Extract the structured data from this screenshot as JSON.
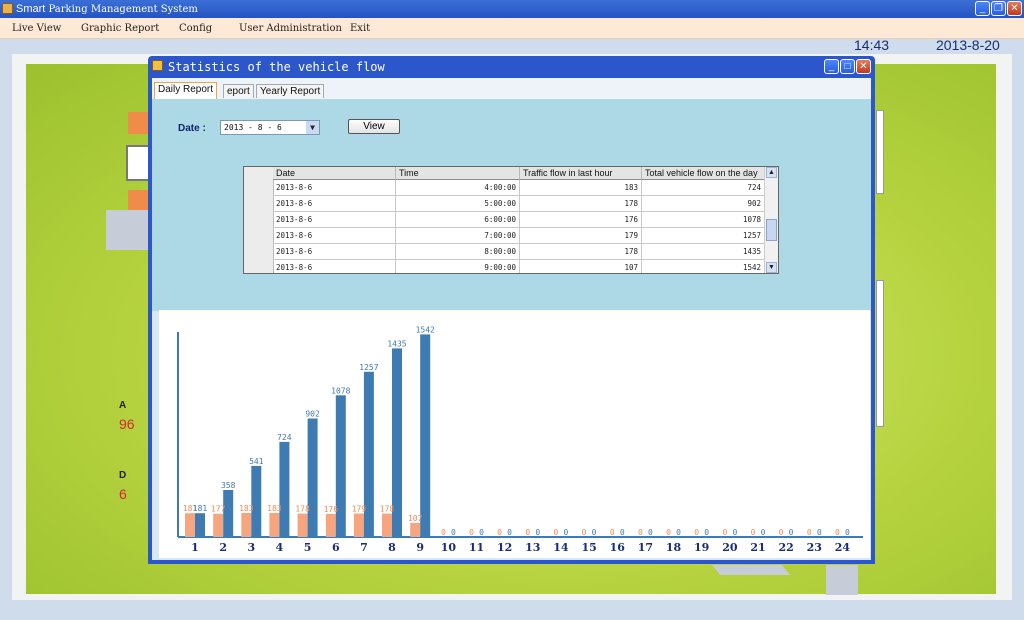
{
  "app": {
    "title_prefix": "Smart",
    "title_rest": "Parking Management System",
    "window_buttons": [
      "_",
      "❐",
      "✕"
    ]
  },
  "menu": [
    "Live View",
    "Graphic Report",
    "Config",
    "User Administration",
    "Exit"
  ],
  "clock": {
    "time": "14:43",
    "date": "2013-8-20"
  },
  "side_labels": [
    {
      "letter": "A",
      "count": "96"
    },
    {
      "letter": "D",
      "count": "6"
    }
  ],
  "dialog": {
    "title": "Statistics of the vehicle flow",
    "tabs": [
      "Daily Report",
      "eport",
      "Yearly Report"
    ],
    "date_label": "Date :",
    "date_value": "2013 - 8 - 6",
    "view_button": "View",
    "table": {
      "columns": [
        "Date",
        "Time",
        "Traffic flow in last hour",
        "Total vehicle flow on the day"
      ],
      "rows": [
        [
          "2013-8-6",
          "4:00:00",
          "183",
          "724"
        ],
        [
          "2013-8-6",
          "5:00:00",
          "178",
          "902"
        ],
        [
          "2013-8-6",
          "6:00:00",
          "176",
          "1078"
        ],
        [
          "2013-8-6",
          "7:00:00",
          "179",
          "1257"
        ],
        [
          "2013-8-6",
          "8:00:00",
          "178",
          "1435"
        ],
        [
          "2013-8-6",
          "9:00:00",
          "107",
          "1542"
        ]
      ]
    }
  },
  "colors": {
    "hourly_bar": "#f7a57e",
    "total_bar": "#3f7bb3",
    "axis_label": "#1b2d72"
  },
  "chart_data": {
    "type": "bar",
    "categories": [
      "1",
      "2",
      "3",
      "4",
      "5",
      "6",
      "7",
      "8",
      "9",
      "10",
      "11",
      "12",
      "13",
      "14",
      "15",
      "16",
      "17",
      "18",
      "19",
      "20",
      "21",
      "22",
      "23",
      "24"
    ],
    "series": [
      {
        "values": [
          181,
          177,
          183,
          183,
          178,
          176,
          179,
          178,
          107,
          0,
          0,
          0,
          0,
          0,
          0,
          0,
          0,
          0,
          0,
          0,
          0,
          0,
          0,
          0
        ]
      },
      {
        "values": [
          181,
          358,
          541,
          724,
          902,
          1078,
          1257,
          1435,
          1542,
          0,
          0,
          0,
          0,
          0,
          0,
          0,
          0,
          0,
          0,
          0,
          0,
          0,
          0,
          0
        ]
      }
    ],
    "value_labels_hourly": [
      "181",
      "177",
      "183",
      "183",
      "178",
      "176",
      "179",
      "178",
      "107",
      "0",
      "0",
      "0",
      "0",
      "0",
      "0",
      "0",
      "0",
      "0",
      "0",
      "0",
      "0",
      "0",
      "0",
      "0"
    ],
    "value_labels_total": [
      "181",
      "358",
      "541",
      "724",
      "902",
      "1078",
      "1257",
      "1435",
      "1542",
      "0",
      "0",
      "0",
      "0",
      "0",
      "0",
      "0",
      "0",
      "0",
      "0",
      "0",
      "0",
      "0",
      "0",
      "0"
    ],
    "ylim": [
      0,
      1560
    ]
  }
}
